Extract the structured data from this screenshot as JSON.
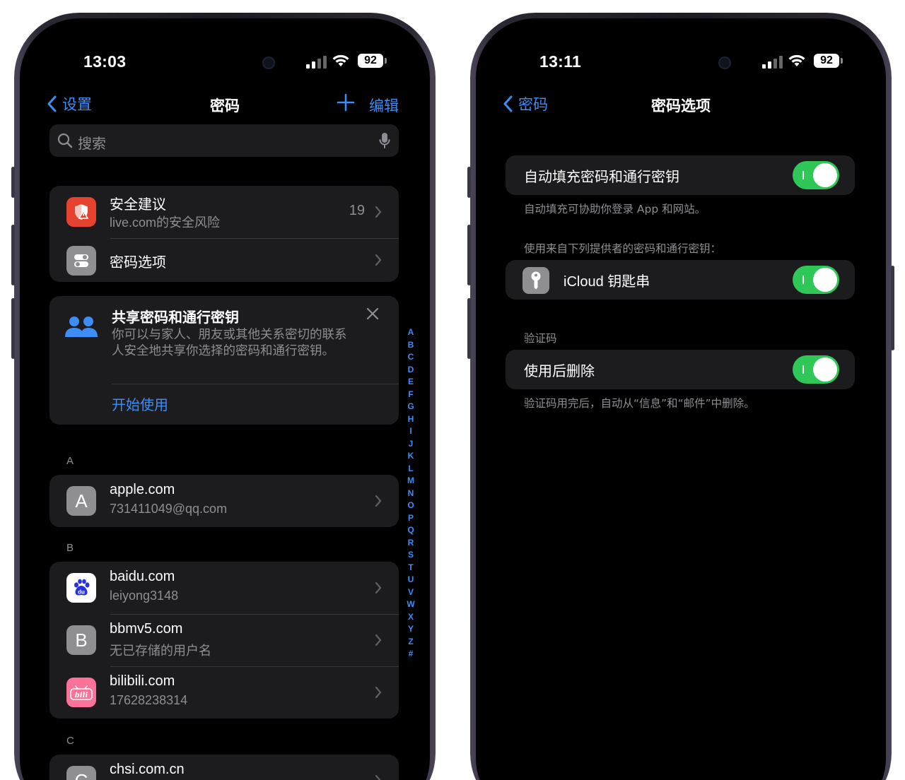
{
  "left_phone": {
    "time": "13:03",
    "battery": "92",
    "nav": {
      "back": "设置",
      "title": "密码",
      "edit": "编辑"
    },
    "search": {
      "placeholder": "搜索"
    },
    "security": {
      "title": "安全建议",
      "subtitle": "live.com的安全风险",
      "count": "19"
    },
    "options_row": {
      "label": "密码选项"
    },
    "share": {
      "title": "共享密码和通行密钥",
      "body": "你可以与家人、朋友或其他关系密切的联系人安全地共享你选择的密码和通行密钥。",
      "action": "开始使用"
    },
    "sections": [
      {
        "letter": "A",
        "items": [
          {
            "icon": "A",
            "site": "apple.com",
            "account": "731411049@qq.com"
          }
        ]
      },
      {
        "letter": "B",
        "items": [
          {
            "icon": "baidu-icon",
            "site": "baidu.com",
            "account": "leiyong3148"
          },
          {
            "icon": "B",
            "site": "bbmv5.com",
            "account": "无已存储的用户名"
          },
          {
            "icon": "bilibili-icon",
            "site": "bilibili.com",
            "account": "17628238314"
          }
        ]
      },
      {
        "letter": "C",
        "items": [
          {
            "icon": "C",
            "site": "chsi.com.cn",
            "account": ""
          }
        ]
      }
    ],
    "index": [
      "A",
      "B",
      "C",
      "D",
      "E",
      "F",
      "G",
      "H",
      "I",
      "J",
      "K",
      "L",
      "M",
      "N",
      "O",
      "P",
      "Q",
      "R",
      "S",
      "T",
      "U",
      "V",
      "W",
      "X",
      "Y",
      "Z",
      "#"
    ]
  },
  "right_phone": {
    "time": "13:11",
    "battery": "92",
    "nav": {
      "back": "密码",
      "title": "密码选项"
    },
    "autofill": {
      "label": "自动填充密码和通行密钥",
      "on": true,
      "note": "自动填充可协助你登录 App 和网站。"
    },
    "providers_header": "使用来自下列提供者的密码和通行密钥：",
    "icloud": {
      "label": "iCloud 钥匙串",
      "on": true
    },
    "codes_header": "验证码",
    "delete_after": {
      "label": "使用后删除",
      "on": true,
      "note": "验证码用完后，自动从“信息”和“邮件”中删除。"
    }
  },
  "colors": {
    "accent": "#3e8cf5",
    "toggle_on": "#30c759",
    "cell_bg": "#1c1c1e",
    "secondary_text": "#8e8e93"
  }
}
